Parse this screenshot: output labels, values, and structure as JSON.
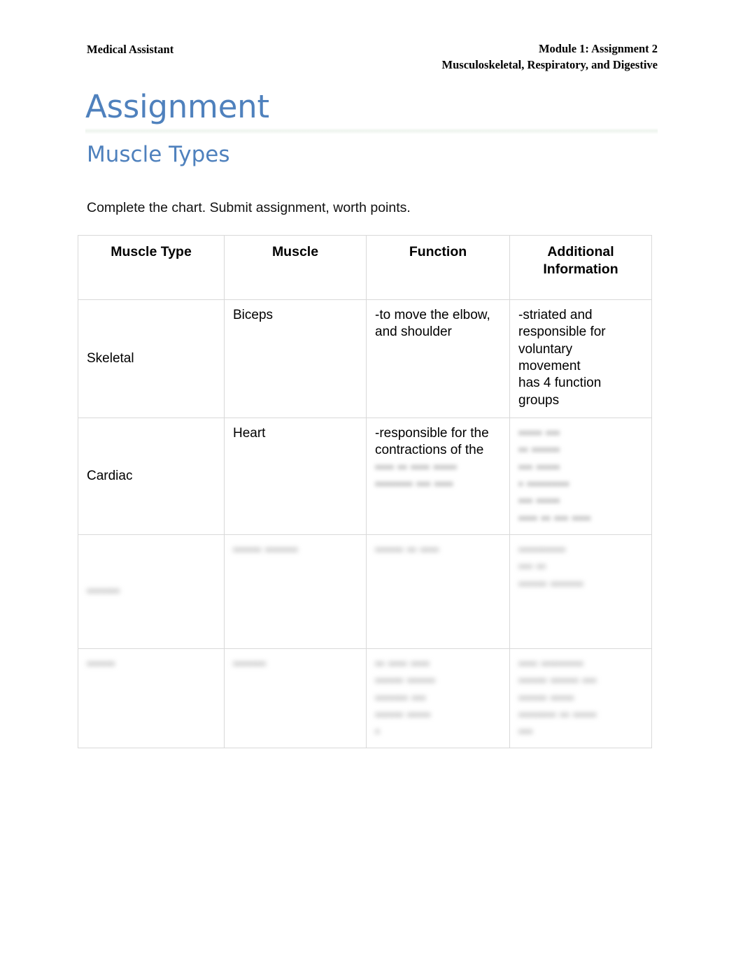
{
  "document": {
    "running_header": {
      "left": "Medical Assistant",
      "right_line1": "Module 1: Assignment 2",
      "right_line2": "Musculoskeletal, Respiratory, and Digestive"
    },
    "title": "Assignment",
    "subtitle": "Muscle Types",
    "instructions": "Complete the chart. Submit assignment, worth points.",
    "accent_color": "#4F81BD",
    "border_color": "#d9d9d9"
  },
  "chart_data": {
    "type": "table",
    "title": "Muscle Types",
    "columns": [
      "Muscle Type",
      "Muscle",
      "Function",
      "Additional Information"
    ],
    "rows": [
      {
        "muscle_type": "Skeletal",
        "muscle": "Biceps",
        "function": [
          "-to move the elbow,",
          "and shoulder"
        ],
        "additional_information": [
          "-striated and",
          "responsible for",
          "voluntary",
          "movement",
          "has 4 function",
          "groups"
        ],
        "redacted": false
      },
      {
        "muscle_type": "Cardiac",
        "muscle": "Heart",
        "function": [
          "-responsible for the",
          "contractions of the"
        ],
        "function_redacted": [
          "▪▪▪▪ ▪▪ ▪▪▪▪ ▪▪▪▪▪",
          "▪▪▪▪▪▪▪▪ ▪▪▪ ▪▪▪▪"
        ],
        "additional_information_redacted": [
          "▪▪▪▪▪ ▪▪▪",
          "▪▪ ▪▪▪▪▪▪",
          "▪▪▪ ▪▪▪▪▪",
          "▪ ▪▪▪▪▪▪▪▪▪",
          "▪▪▪ ▪▪▪▪▪",
          "▪▪▪▪ ▪▪ ▪▪▪ ▪▪▪▪",
          "▪▪▪▪▪ ▪▪▪▪",
          "▪▪▪▪▪▪▪▪ ▪▪▪▪▪▪▪▪▪"
        ],
        "redacted": true
      },
      {
        "muscle_type_redacted": "▪▪▪▪▪▪▪",
        "muscle_redacted": "▪▪▪▪▪▪ ▪▪▪▪▪▪▪",
        "function_redacted": [
          "▪▪▪▪▪▪ ▪▪ ▪▪▪▪"
        ],
        "additional_information_redacted": [
          "▪▪▪▪▪▪▪▪▪▪",
          "▪▪▪ ▪▪",
          "▪▪▪▪▪▪ ▪▪▪▪▪▪▪"
        ],
        "redacted": true
      },
      {
        "muscle_type_redacted": "▪▪▪▪▪▪",
        "muscle_redacted": "▪▪▪▪▪▪▪",
        "function_redacted": [
          "▪▪ ▪▪▪▪ ▪▪▪▪",
          "▪▪▪▪▪▪ ▪▪▪▪▪▪",
          "▪▪▪▪▪▪▪ ▪▪▪",
          "▪▪▪▪▪▪ ▪▪▪▪▪",
          "▪"
        ],
        "additional_information_redacted": [
          "▪▪▪▪ ▪▪▪▪▪▪▪▪▪",
          "▪▪▪▪▪▪ ▪▪▪▪▪▪ ▪▪▪",
          "▪▪▪▪▪▪ ▪▪▪▪▪",
          "▪▪▪▪▪▪▪▪ ▪▪ ▪▪▪▪▪",
          "▪▪▪"
        ],
        "redacted": true
      }
    ],
    "note": "Rows 3 and 4 and trailing lines of row 2 are visually blurred/redacted in the source image and their text is not legible."
  }
}
